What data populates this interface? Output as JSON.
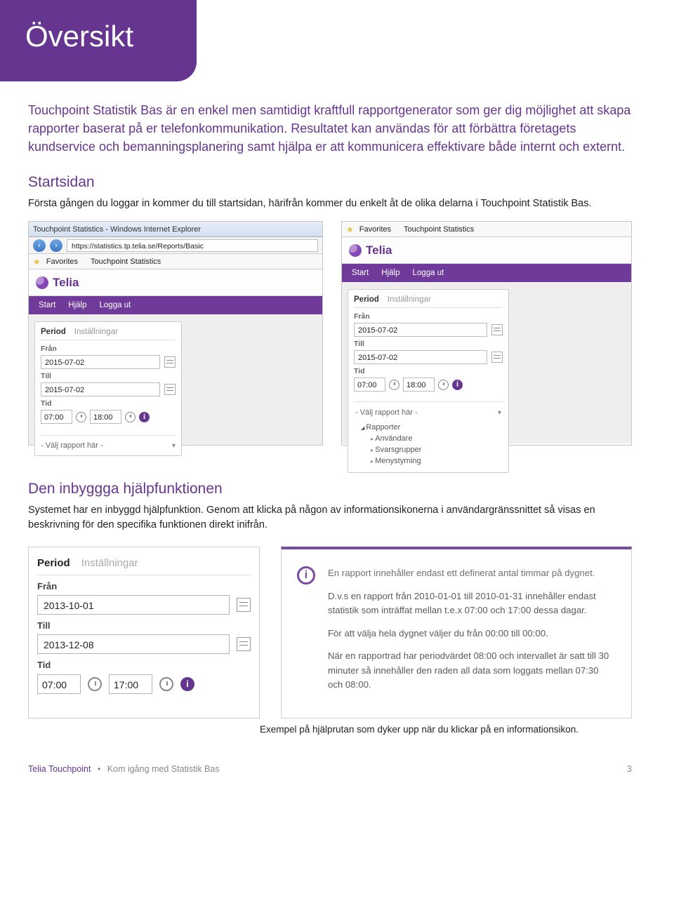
{
  "header": {
    "title": "Översikt"
  },
  "intro": {
    "text": "Touchpoint Statistik Bas är en enkel men samtidigt kraftfull rapportgenerator som ger dig möjlighet att skapa rapporter baserat på er telefonkommunikation. Resultatet kan användas för att förbättra företagets kundservice och bemanningsplanering samt hjälpa er att kommunicera effektivare både internt och externt."
  },
  "startsidan": {
    "heading": "Startsidan",
    "lead": "Första gången du loggar in kommer du till startsidan, härifrån kommer du enkelt åt de olika delarna i Touchpoint Statistik Bas."
  },
  "ie": {
    "title": "Touchpoint Statistics - Windows Internet Explorer",
    "url_icon": "e",
    "url": "https://statistics.tp.telia.se/Reports/Basic",
    "favorites": "Favorites",
    "tab": "Touchpoint Statistics"
  },
  "telia": {
    "brand": "Telia",
    "nav": [
      "Start",
      "Hjälp",
      "Logga ut"
    ]
  },
  "period_panel": {
    "tab_active": "Period",
    "tab_inactive": "Inställningar",
    "from_label": "Från",
    "from_value": "2015-07-02",
    "till_label": "Till",
    "till_value": "2015-07-02",
    "tid_label": "Tid",
    "time_from": "07:00",
    "time_to": "18:00",
    "select_placeholder": "- Välj rapport här -",
    "dd_group": "Rapporter",
    "dd_items": [
      "Användare",
      "Svarsgrupper",
      "Menystyrning"
    ]
  },
  "help_section": {
    "heading": "Den inbyggga hjälpfunktionen",
    "lead": "Systemet har en inbyggd hjälpfunktion. Genom att klicka på någon av informationsikonerna i användargränssnittet så visas en beskrivning för den specifika funktionen direkt inifrån."
  },
  "period_panel2": {
    "tab_active": "Period",
    "tab_inactive": "Inställningar",
    "from_label": "Från",
    "from_value": "2013-10-01",
    "till_label": "Till",
    "till_value": "2013-12-08",
    "tid_label": "Tid",
    "time_from": "07:00",
    "time_to": "17:00"
  },
  "help_box": {
    "p1": "En rapport innehåller endast ett definerat antal timmar på dygnet.",
    "p2": "D.v.s en rapport från 2010-01-01 till 2010-01-31 innehåller endast statistik som inträffat mellan t.e.x 07:00 och 17:00 dessa dagar.",
    "p3": "För att välja hela dygnet väljer du från 00:00 till 00:00.",
    "p4": "När en rapportrad har periodvärdet 08:00 och intervallet är satt till 30 minuter så innehåller den raden all data som loggats mellan 07:30 och 08:00."
  },
  "caption": "Exempel på hjälprutan som dyker upp när du klickar på en informationsikon.",
  "footer": {
    "left1": "Telia Touchpoint",
    "sep": "•",
    "left2": "Kom igång med Statistik Bas",
    "page": "3"
  }
}
